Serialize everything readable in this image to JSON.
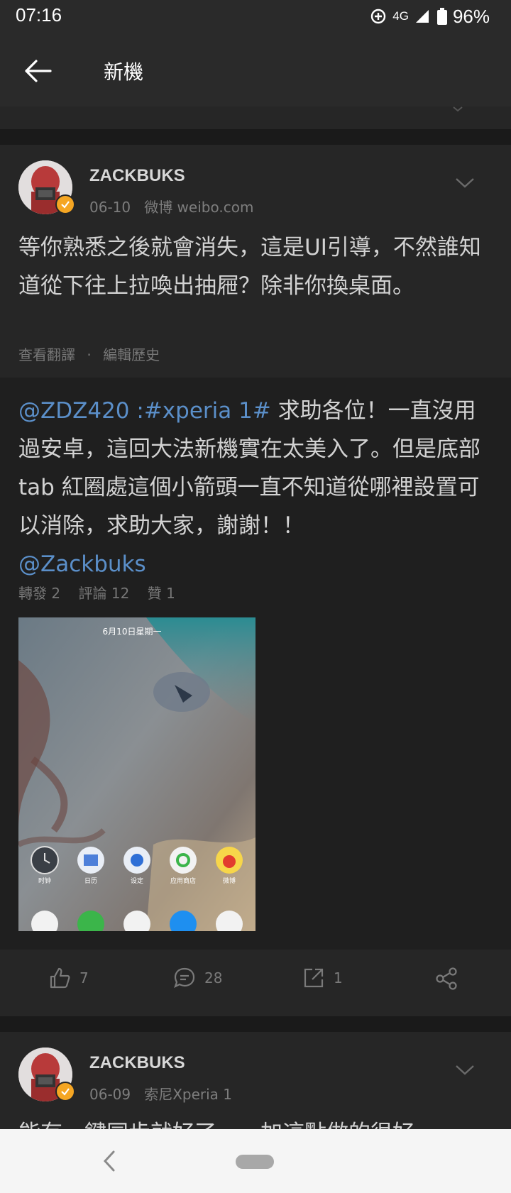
{
  "status_bar": {
    "time": "07:16",
    "network": "4G",
    "battery": "96%"
  },
  "top_bar": {
    "title": "新機",
    "back_icon": "arrow-left-icon"
  },
  "post1": {
    "username": "ZACKBUKS",
    "date": "06-10",
    "source": "微博 weibo.com",
    "text": "等你熟悉之後就會消失，這是UI引導，不然誰知道從下往上拉喚出抽屜？除非你換桌面。",
    "translate_label": "查看翻譯",
    "separator": "·",
    "history_label": "編輯歷史"
  },
  "repost": {
    "mention": "@ZDZ420",
    "colon": " :",
    "hashtag": "#xperia 1#",
    "text": " 求助各位！一直沒用過安卓，這回大法新機實在太美入了。但是底部 tab 紅圈處這個小箭頭一直不知道從哪裡設置可以消除，求助大家，謝謝！！",
    "mention2": "@Zackbuks",
    "reposts_label": "轉發 2",
    "comments_label": "評論 12",
    "likes_label": "贊 1",
    "photo": {
      "date_line": "6月10日星期一",
      "apps": [
        "时钟",
        "日历",
        "设定",
        "应用商店",
        "微博"
      ]
    }
  },
  "actions": {
    "like_count": "7",
    "comment_count": "28",
    "repost_count": "1"
  },
  "post2": {
    "username": "ZACKBUKS",
    "date": "06-09",
    "source": "索尼Xperia 1",
    "text_partial": "能有一鍵同步就好了。…加這點做的很好。"
  },
  "colors": {
    "background": "#1c1c1c",
    "card": "#262626",
    "link": "#5b8fc9",
    "verified": "#f5a623"
  }
}
